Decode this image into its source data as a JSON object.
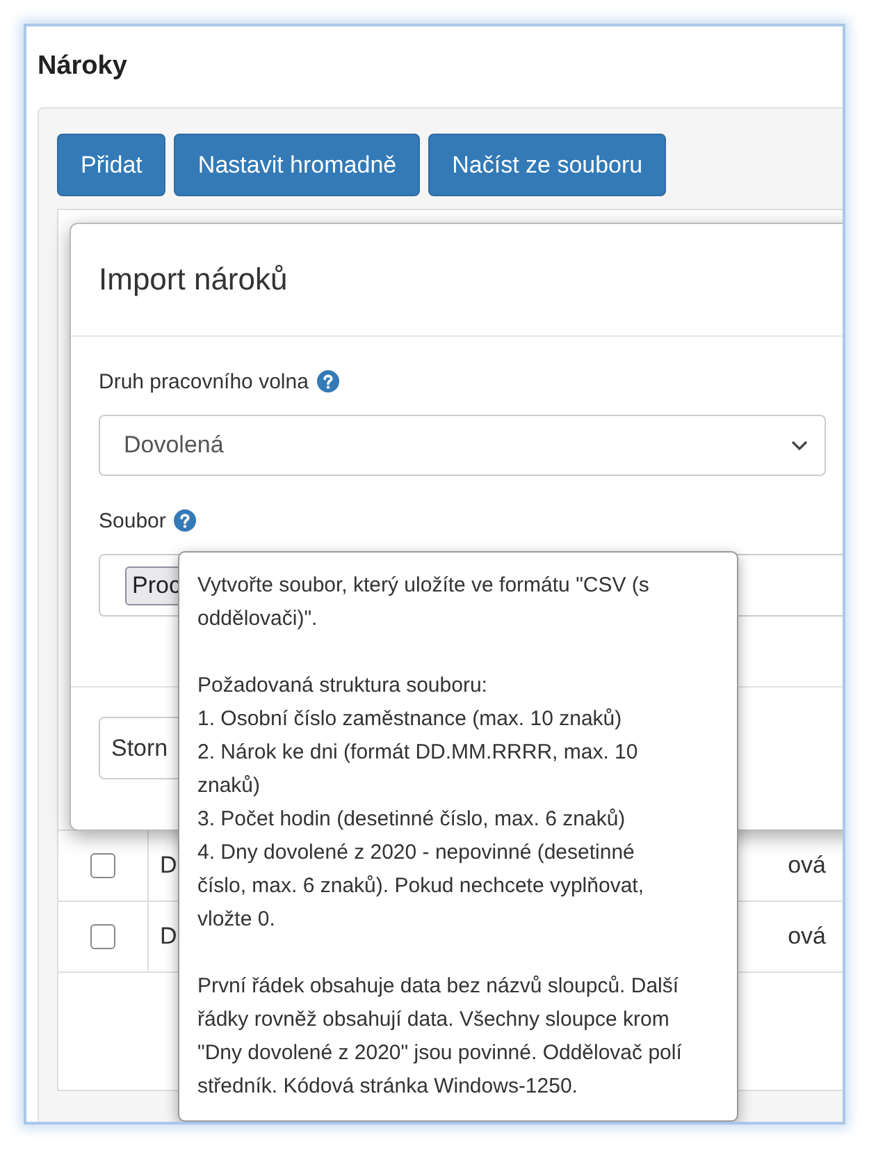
{
  "page": {
    "title": "Nároky"
  },
  "toolbar": {
    "buttons": [
      "Přidat",
      "Nastavit hromadně",
      "Načíst ze souboru"
    ]
  },
  "table": {
    "rows": [
      {
        "checked": false,
        "column_2": "D",
        "column_3": "ová"
      },
      {
        "checked": false,
        "column_2": "D",
        "column_3": "ová"
      }
    ]
  },
  "dialog": {
    "title": "Import nároků",
    "fields": [
      {
        "kind": "select",
        "label": "Druh pracovního volna",
        "value": "Dovolená"
      },
      {
        "kind": "file",
        "label": "Soubor",
        "button": "Proc"
      }
    ],
    "footer_button": "Storn"
  },
  "tooltip": {
    "intro": "Vytvořte soubor, který uložíte ve formátu \"CSV (s oddělovači)\".",
    "structure_title": "Požadovaná struktura souboru:",
    "structure_items": [
      "1. Osobní číslo zaměstnance (max. 10 znaků)",
      "2. Nárok ke dni (formát DD.MM.RRRR, max. 10 znaků)",
      "3. Počet hodin (desetinné číslo, max. 6 znaků)",
      "4. Dny dovolené z 2020 - nepovinné (desetinné číslo, max. 6 znaků). Pokud nechcete vyplňovat, vložte 0."
    ],
    "note": "První řádek obsahuje data bez názvů sloupců. Další řádky rovněž obsahují data. Všechny sloupce krom \"Dny dovolené z 2020\" jsou povinné. Oddělovač polí středník. Kódová stránka Windows-1250."
  }
}
